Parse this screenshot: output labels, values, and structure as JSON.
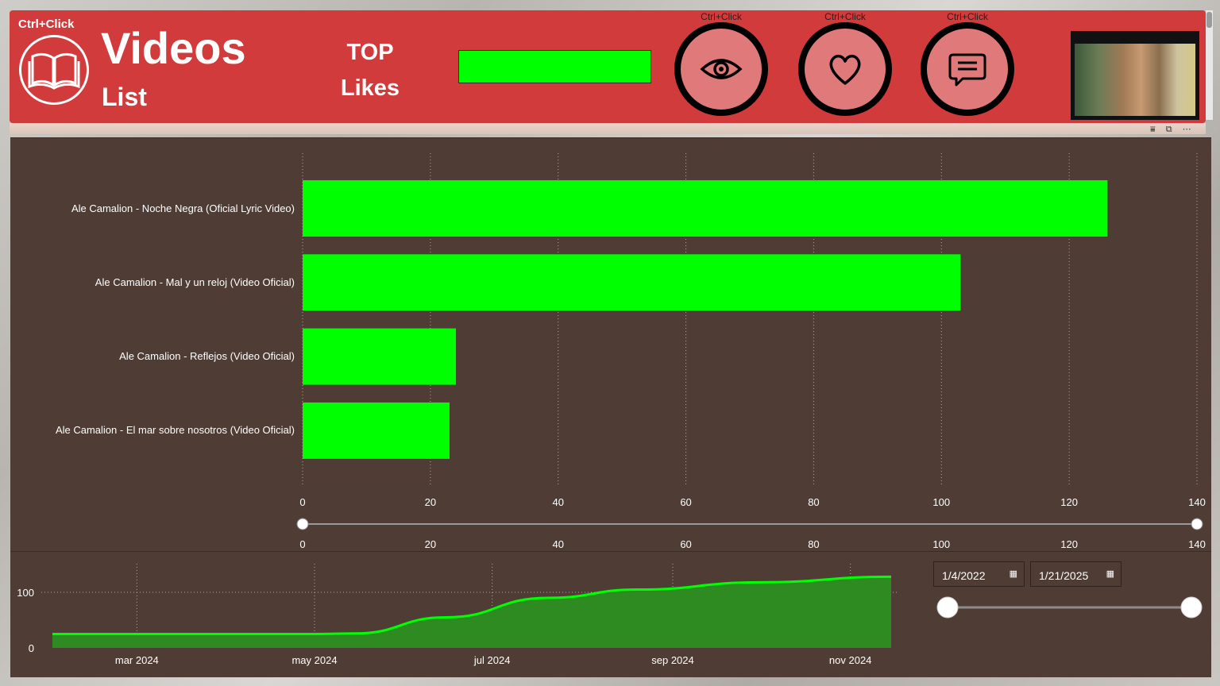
{
  "header": {
    "ctrl_hint": "Ctrl+Click",
    "title_main": "Videos",
    "title_sub": "List",
    "top_label_1": "TOP",
    "top_label_2": "Likes",
    "nav_buttons": [
      {
        "caption": "Ctrl+Click",
        "icon": "eye-icon"
      },
      {
        "caption": "Ctrl+Click",
        "icon": "heart-icon"
      },
      {
        "caption": "Ctrl+Click",
        "icon": "comment-icon"
      }
    ],
    "book_icon": "book-icon",
    "top_box_color": "#00ff00"
  },
  "colors": {
    "header_bg": "#d13b3b",
    "panel_bg": "#4e3c35",
    "bar_color": "#00ff00",
    "area_fill": "#2e8b22"
  },
  "chart_data": [
    {
      "type": "bar",
      "orientation": "horizontal",
      "categories": [
        "Ale Camalion - Noche Negra (Oficial Lyric Video)",
        "Ale Camalion - Mal y un reloj (Video Oficial)",
        "Ale Camalion - Reflejos (Video Oficial)",
        "Ale Camalion - El mar sobre nosotros (Video Oficial)"
      ],
      "values": [
        126,
        103,
        24,
        23
      ],
      "xlim": [
        0,
        140
      ],
      "xticks": [
        "0",
        "20",
        "40",
        "60",
        "80",
        "100",
        "120",
        "140"
      ],
      "grid": true,
      "slider_labels": [
        "0",
        "20",
        "40",
        "60",
        "80",
        "100",
        "120",
        "140"
      ]
    },
    {
      "type": "area",
      "x": [
        "2024-02-01",
        "2024-05-01",
        "2024-05-15",
        "2024-06-15",
        "2024-07-20",
        "2024-08-20",
        "2024-10-01",
        "2024-11-15"
      ],
      "values": [
        25,
        25,
        26,
        55,
        90,
        105,
        118,
        128
      ],
      "xticks": [
        "mar 2024",
        "may 2024",
        "jul 2024",
        "sep 2024",
        "nov 2024"
      ],
      "yticks": [
        "0",
        "100"
      ],
      "ylim": [
        0,
        150
      ]
    }
  ],
  "date_filter": {
    "start": "1/4/2022",
    "end": "1/21/2025",
    "calendar_icon": "calendar-icon"
  }
}
